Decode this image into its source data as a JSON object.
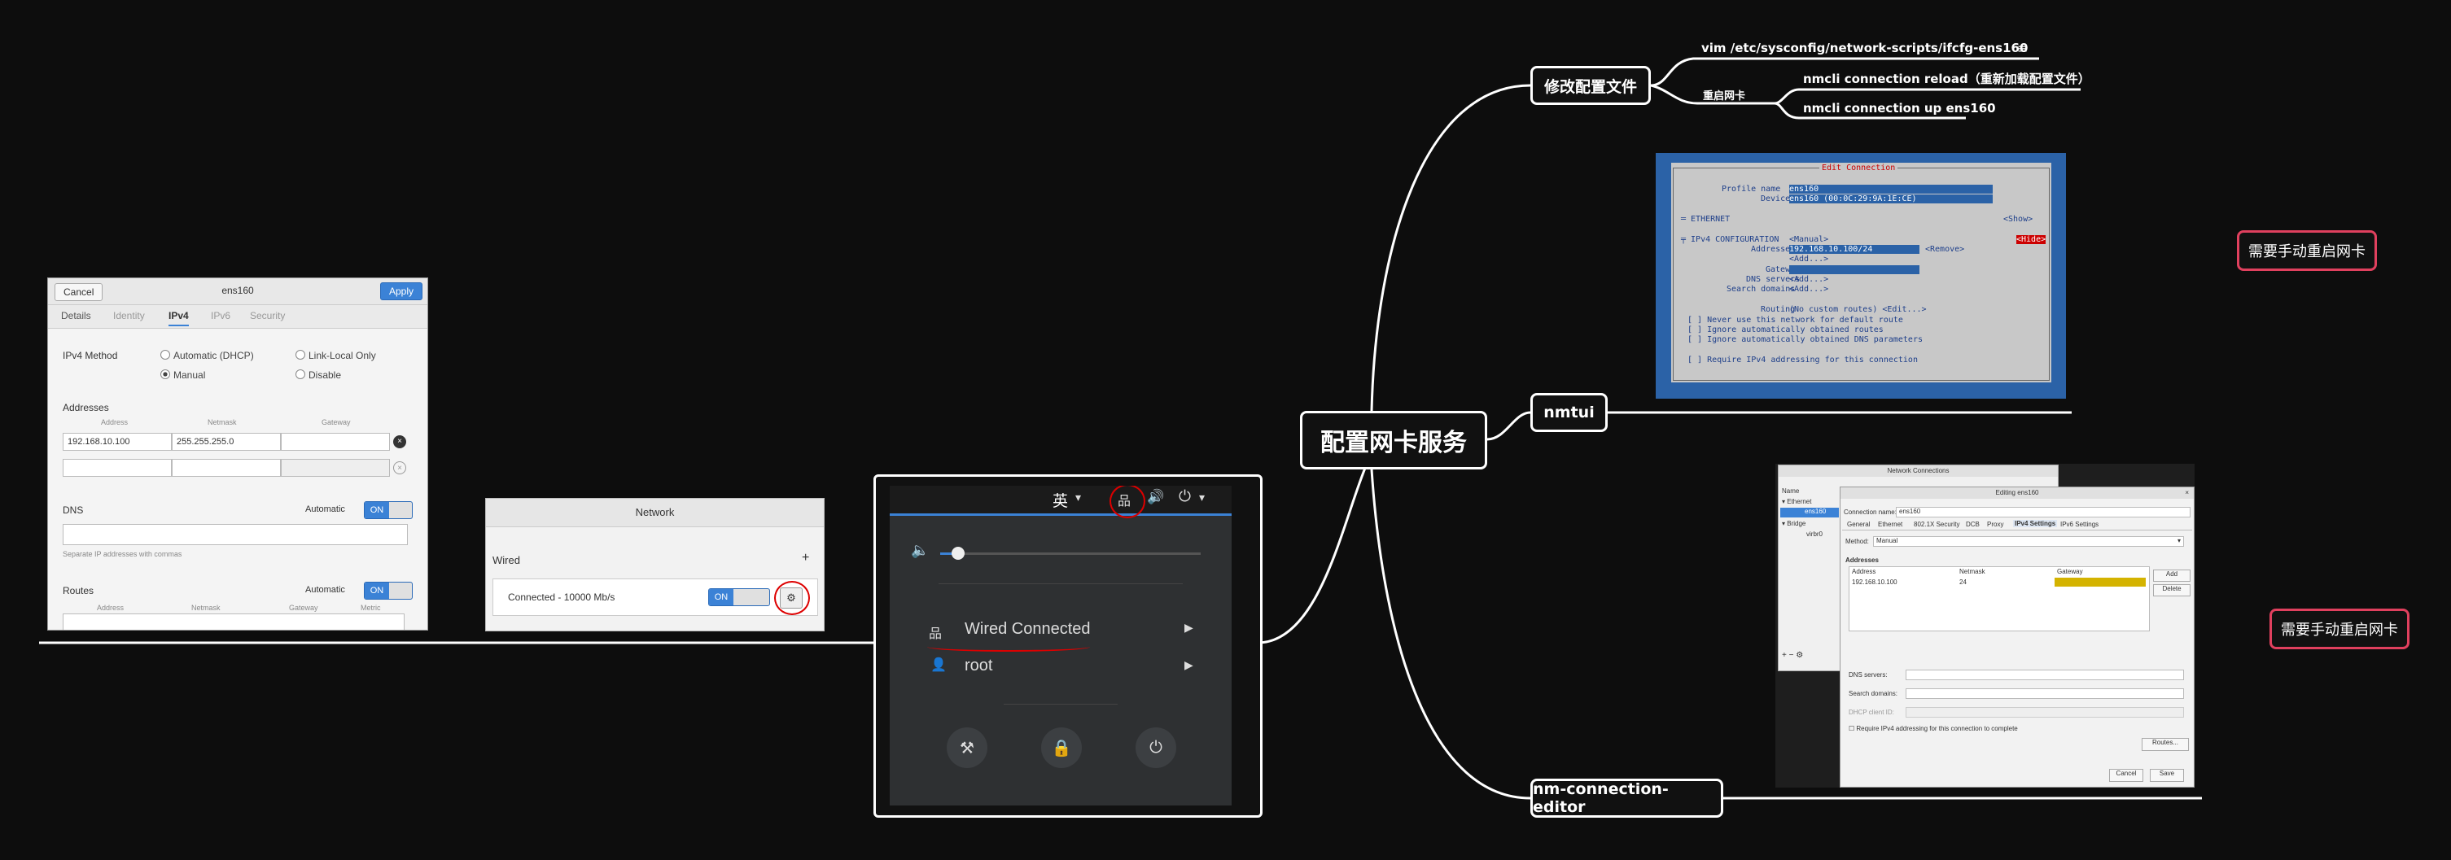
{
  "mindmap": {
    "root": "配置网卡服务",
    "branch_config_file": "修改配置文件",
    "cmd_vim": "vim /etc/sysconfig/network-scripts/ifcfg-ens160",
    "restart_nic": "重启网卡",
    "cmd_reload": "nmcli connection reload（重新加载配置文件）",
    "cmd_up": "nmcli connection up ens160",
    "branch_nmtui": "nmtui",
    "branch_nmce": "nm-connection-editor",
    "note_restart_1": "需要手动重启网卡",
    "note_restart_2": "需要手动重启网卡"
  },
  "ipv4_dialog": {
    "cancel": "Cancel",
    "title": "ens160",
    "apply": "Apply",
    "tabs": [
      "Details",
      "Identity",
      "IPv4",
      "IPv6",
      "Security"
    ],
    "method_label": "IPv4 Method",
    "methods": [
      "Automatic (DHCP)",
      "Link-Local Only",
      "Manual",
      "Disable"
    ],
    "addresses_label": "Addresses",
    "col_address": "Address",
    "col_netmask": "Netmask",
    "col_gateway": "Gateway",
    "address": "192.168.10.100",
    "netmask": "255.255.255.0",
    "dns_label": "DNS",
    "automatic": "Automatic",
    "on": "ON",
    "dns_hint": "Separate IP addresses with commas",
    "routes_label": "Routes",
    "col_metric": "Metric"
  },
  "network_panel": {
    "title": "Network",
    "wired": "Wired",
    "add": "+",
    "status": "Connected - 10000 Mb/s",
    "on": "ON"
  },
  "system_menu": {
    "lang": "英",
    "wired": "Wired Connected",
    "user": "root"
  },
  "nmtui": {
    "title": "Edit Connection",
    "profile_name_label": "Profile name",
    "profile_name": "ens160",
    "device_label": "Device",
    "device": "ens160 (00:0C:29:9A:1E:CE)",
    "ethernet": "═ ETHERNET",
    "show": "<Show>",
    "ipv4_conf": "╤ IPv4 CONFIGURATION",
    "manual": "<Manual>",
    "hide": "<Hide>",
    "addresses_label": "Addresses",
    "address": "192.168.10.100/24",
    "remove": "<Remove>",
    "add": "<Add...>",
    "gateway_label": "Gateway",
    "dns_label": "DNS servers",
    "search_label": "Search domains",
    "routing_label": "Routing",
    "routing": "(No custom routes) <Edit...>",
    "chk1": "[ ] Never use this network for default route",
    "chk2": "[ ] Ignore automatically obtained routes",
    "chk3": "[ ] Ignore automatically obtained DNS parameters",
    "chk4": "[ ] Require IPv4 addressing for this connection"
  },
  "nm_editor": {
    "list_title": "Network Connections",
    "col_name": "Name",
    "ethernet": "▾ Ethernet",
    "ens160": "ens160",
    "bridge": "▾ Bridge",
    "virbr0": "virbr0",
    "edit_title": "Editing ens160",
    "conn_name_label": "Connection name:",
    "conn_name": "ens160",
    "tabs": [
      "General",
      "Ethernet",
      "802.1X Security",
      "DCB",
      "Proxy",
      "IPv4 Settings",
      "IPv6 Settings"
    ],
    "method_label": "Method:",
    "method": "Manual",
    "addresses": "Addresses",
    "col_address": "Address",
    "col_netmask": "Netmask",
    "col_gateway": "Gateway",
    "address": "192.168.10.100",
    "netmask": "24",
    "add": "Add",
    "delete": "Delete",
    "dns_label": "DNS servers:",
    "search_label": "Search domains:",
    "dhcp_label": "DHCP client ID:",
    "require": "Require IPv4 addressing for this connection to complete",
    "routes": "Routes...",
    "cancel": "Cancel",
    "save": "Save"
  }
}
